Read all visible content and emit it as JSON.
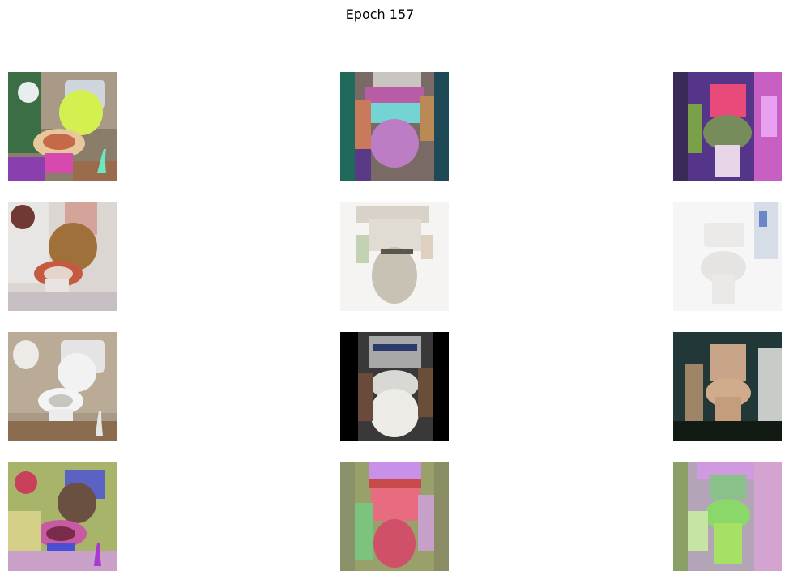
{
  "figure": {
    "title": "Epoch 157"
  },
  "grid": {
    "rows": 4,
    "cols": 3,
    "images": [
      {
        "subject": "toilet",
        "style": "segmentation-colored bathroom, yellow-green lid, pink base"
      },
      {
        "subject": "toilet",
        "style": "segmentation-colored toilet front view, purple seat, teal walls"
      },
      {
        "subject": "toilet",
        "style": "segmentation-colored toilet, green lid, purple walls"
      },
      {
        "subject": "toilet",
        "style": "photo-like toilet with brown wooden seat, white tiles"
      },
      {
        "subject": "toilet",
        "style": "washed-out white toilet front view"
      },
      {
        "subject": "toilet",
        "style": "white toilet on white background"
      },
      {
        "subject": "toilet",
        "style": "white toilet with paper holder, beige tiles"
      },
      {
        "subject": "toilet",
        "style": "white toilet front view, black borders"
      },
      {
        "subject": "toilet",
        "style": "beige toilet, dark background"
      },
      {
        "subject": "toilet",
        "style": "normal-map colored toilet, dark lid"
      },
      {
        "subject": "toilet",
        "style": "normal-map colored toilet, red bowl"
      },
      {
        "subject": "toilet",
        "style": "normal-map colored toilet, green"
      }
    ]
  }
}
